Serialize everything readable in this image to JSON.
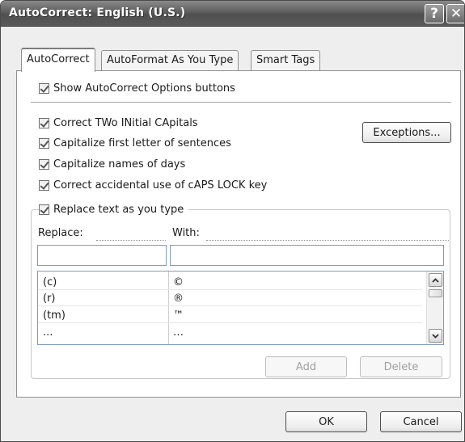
{
  "window": {
    "title": "AutoCorrect: English (U.S.)",
    "help_glyph": "?",
    "close_glyph": "✕"
  },
  "tabs": [
    {
      "label": "AutoCorrect",
      "active": true
    },
    {
      "label": "AutoFormat As You Type",
      "active": false
    },
    {
      "label": "Smart Tags",
      "active": false
    }
  ],
  "options": {
    "show_buttons": {
      "label": "Show AutoCorrect Options buttons",
      "checked": true
    },
    "two_initial_caps": {
      "label": "Correct TWo INitial CApitals",
      "checked": true
    },
    "capitalize_sentences": {
      "label": "Capitalize first letter of sentences",
      "checked": true
    },
    "capitalize_days": {
      "label": "Capitalize names of days",
      "checked": true
    },
    "caps_lock": {
      "label": "Correct accidental use of cAPS LOCK key",
      "checked": true
    },
    "replace_text": {
      "label": "Replace text as you type",
      "checked": true
    }
  },
  "buttons": {
    "exceptions": "Exceptions...",
    "add": "Add",
    "delete": "Delete",
    "ok": "OK",
    "cancel": "Cancel"
  },
  "replace": {
    "replace_label": "Replace:",
    "with_label": "With:",
    "replace_value": "",
    "with_value": ""
  },
  "entries": [
    {
      "replace": "(c)",
      "with": "©"
    },
    {
      "replace": "(r)",
      "with": "®"
    },
    {
      "replace": "(tm)",
      "with": "™"
    },
    {
      "replace": "...",
      "with": "…"
    }
  ],
  "icons": {
    "scroll_up": "chevron-up-icon",
    "scroll_down": "chevron-down-icon"
  }
}
